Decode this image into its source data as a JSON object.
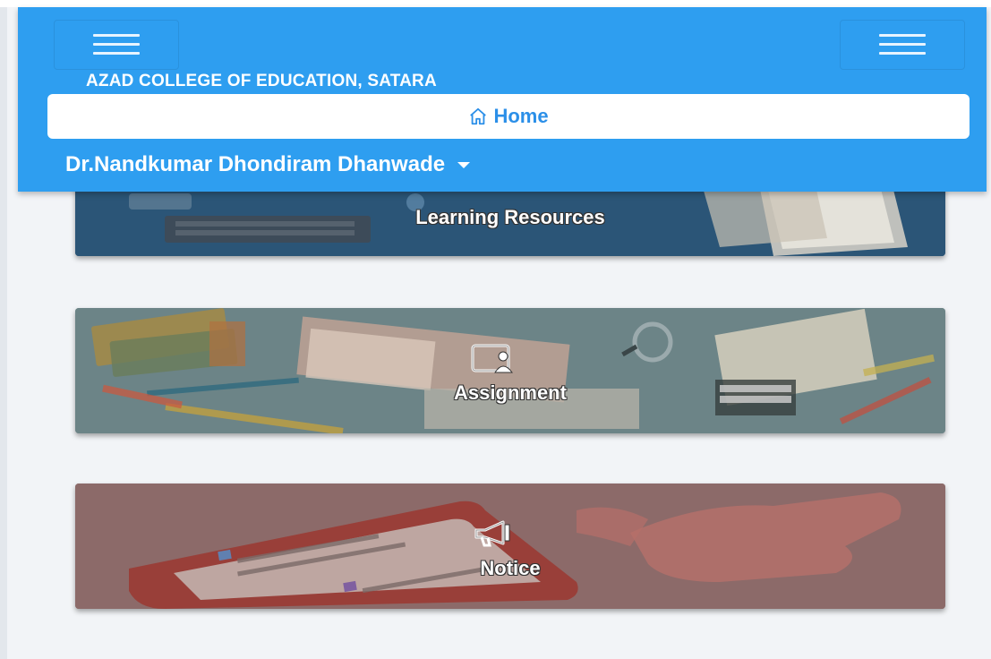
{
  "header": {
    "college_name": "AZAD COLLEGE OF EDUCATION, SATARA",
    "home_label": "Home",
    "user_name": "Dr.Nandkumar Dhondiram Dhanwade",
    "color": "#2e9ef0"
  },
  "cards": [
    {
      "label": "Learning Resources",
      "icon": "book-icon"
    },
    {
      "label": "Assignment",
      "icon": "presentation-icon"
    },
    {
      "label": "Notice",
      "icon": "megaphone-icon"
    }
  ]
}
